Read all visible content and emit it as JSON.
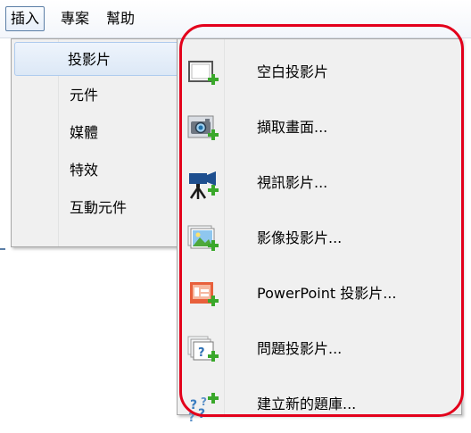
{
  "menubar": {
    "items": [
      {
        "label": "插入",
        "active": true
      },
      {
        "label": "專案"
      },
      {
        "label": "幫助"
      }
    ]
  },
  "insert_menu": {
    "items": [
      {
        "label": "投影片",
        "has_submenu": true,
        "highlighted": true
      },
      {
        "label": "元件",
        "has_submenu": true
      },
      {
        "label": "媒體",
        "has_submenu": true
      },
      {
        "label": "特效",
        "has_submenu": true
      },
      {
        "label": "互動元件",
        "has_submenu": true
      }
    ]
  },
  "slide_submenu": {
    "items": [
      {
        "label": "空白投影片",
        "icon": "blank-slide-icon"
      },
      {
        "label": "擷取畫面...",
        "icon": "screen-capture-icon"
      },
      {
        "label": "視訊影片...",
        "icon": "video-camera-icon"
      },
      {
        "label": "影像投影片...",
        "icon": "image-slide-icon"
      },
      {
        "label": "PowerPoint 投影片...",
        "icon": "powerpoint-icon"
      },
      {
        "label": "問題投影片...",
        "icon": "question-slide-icon"
      },
      {
        "label": "建立新的題庫...",
        "icon": "question-bank-icon"
      }
    ]
  },
  "colors": {
    "highlight_ring": "#e3001b",
    "plus_green": "#3aa82b"
  }
}
